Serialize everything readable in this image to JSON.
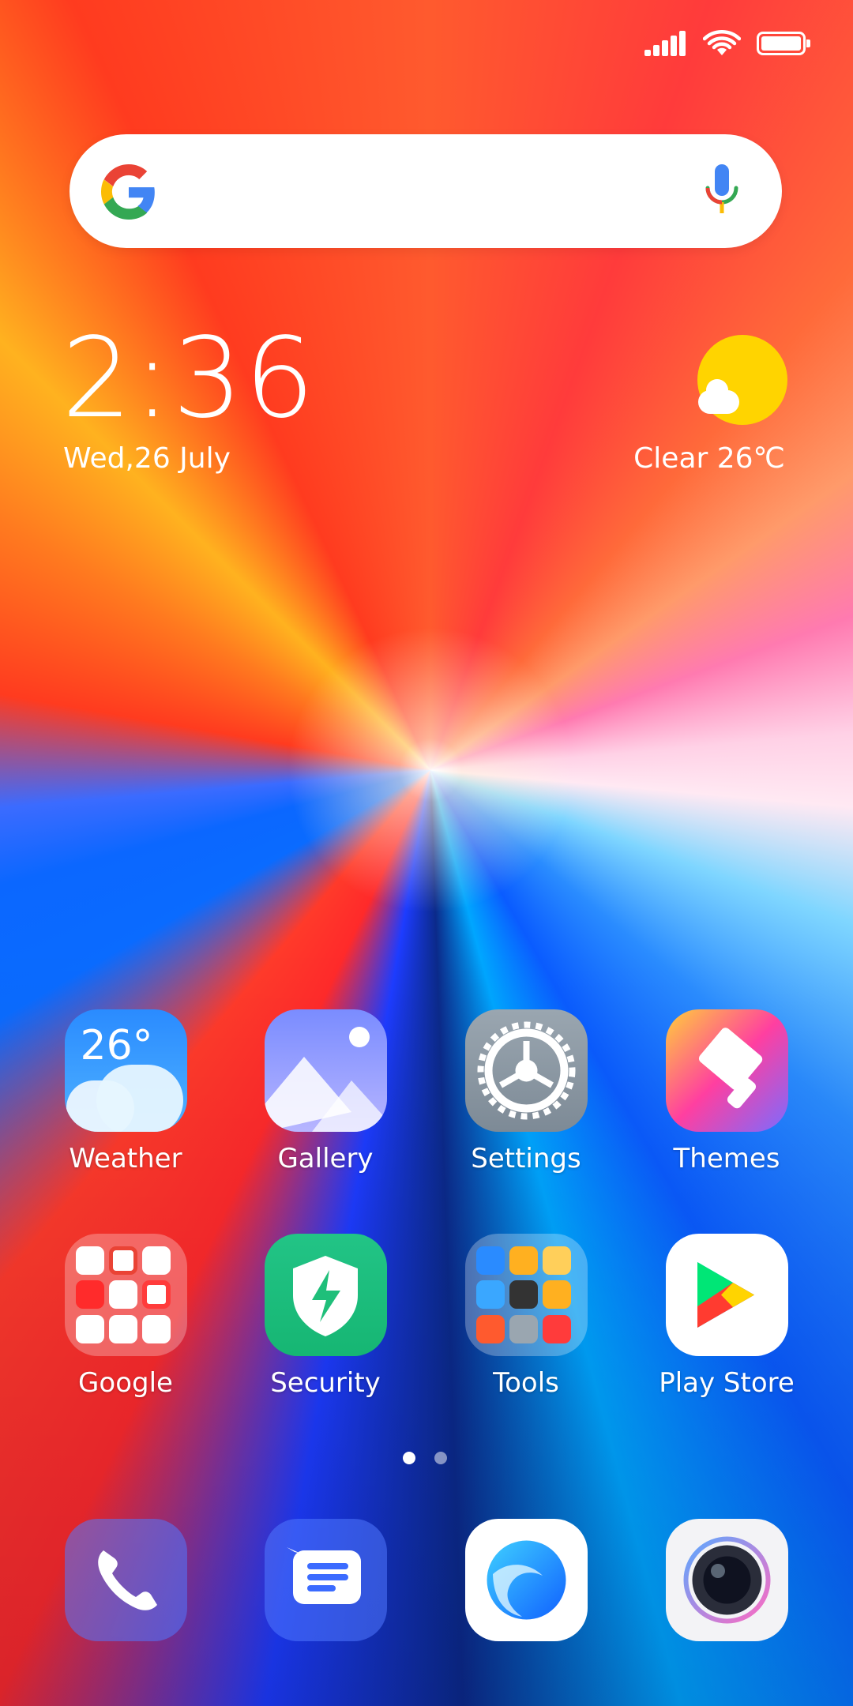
{
  "status_bar": {
    "icons": [
      "signal-icon",
      "wifi-icon",
      "battery-icon"
    ]
  },
  "search_bar": {
    "icons": [
      "google-g-icon",
      "microphone-icon"
    ]
  },
  "clock_widget": {
    "time": "2:36",
    "date": "Wed,26 July"
  },
  "weather_widget": {
    "condition": "Clear 26℃",
    "icon": "sun-cloud-icon"
  },
  "home_apps": [
    {
      "name": "Weather",
      "icon": "weather-icon",
      "badge_text": "26°"
    },
    {
      "name": "Gallery",
      "icon": "gallery-icon"
    },
    {
      "name": "Settings",
      "icon": "settings-gear-icon"
    },
    {
      "name": "Themes",
      "icon": "themes-brush-icon"
    },
    {
      "name": "Google",
      "icon": "google-folder-icon"
    },
    {
      "name": "Security",
      "icon": "security-shield-icon"
    },
    {
      "name": "Tools",
      "icon": "tools-folder-icon"
    },
    {
      "name": "Play Store",
      "icon": "play-store-icon"
    }
  ],
  "page_indicator": {
    "pages": 2,
    "current": 1
  },
  "dock": [
    {
      "icon": "phone-icon"
    },
    {
      "icon": "messages-icon"
    },
    {
      "icon": "browser-icon"
    },
    {
      "icon": "camera-icon"
    }
  ],
  "colors": {
    "accent_google_blue": "#4285F4",
    "accent_google_red": "#EA4335",
    "accent_google_yellow": "#FBBC05",
    "accent_google_green": "#34A853",
    "security_green": "#1FBF7A",
    "sun_yellow": "#FFD400"
  }
}
